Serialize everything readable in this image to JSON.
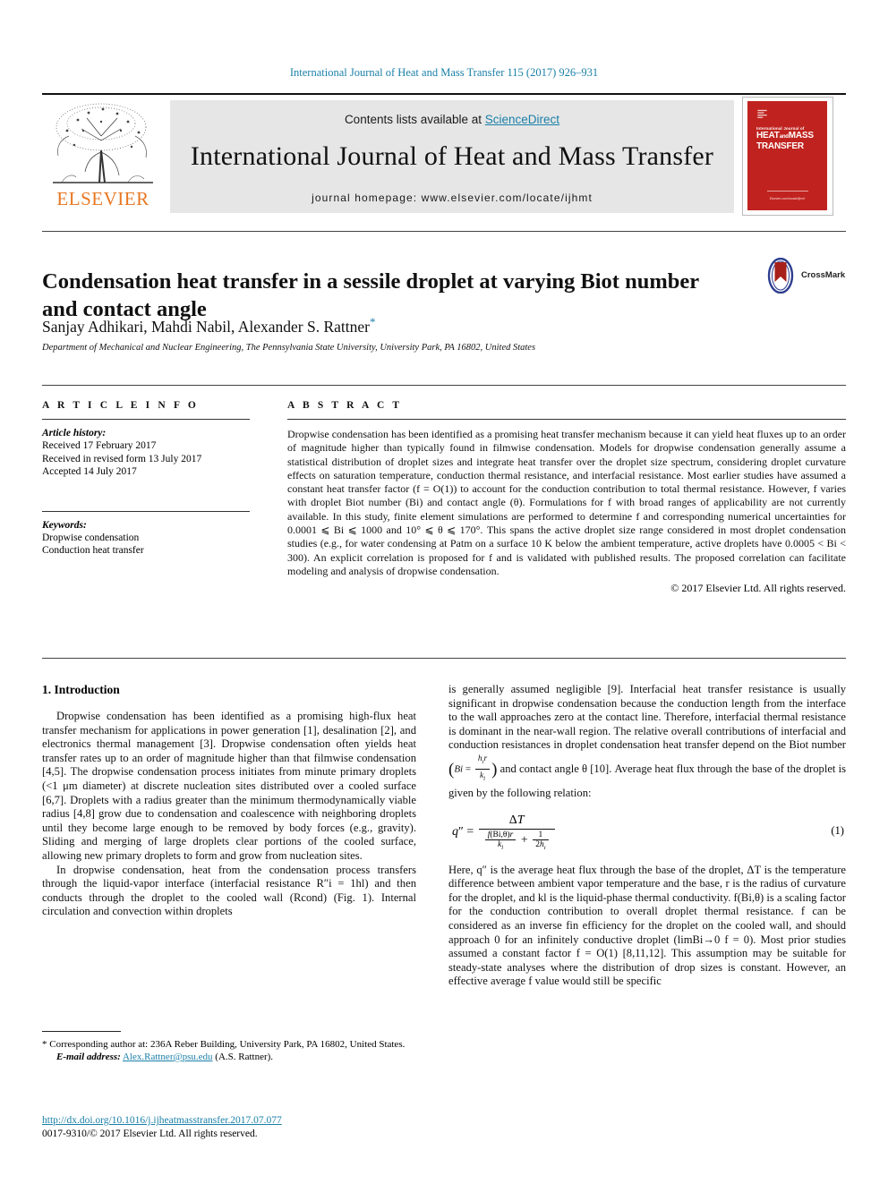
{
  "running_head": "International Journal of Heat and Mass Transfer 115 (2017) 926–931",
  "masthead": {
    "contents_prefix": "Contents lists available at ",
    "sciencedirect": "ScienceDirect",
    "journal_title": "International Journal of Heat and Mass Transfer",
    "homepage": "journal homepage: www.elsevier.com/locate/ijhmt",
    "publisher_name": "ELSEVIER",
    "cover": {
      "line1": "International Journal of",
      "line2_a": "HEAT",
      "line2_b": "and",
      "line2_c": "MASS",
      "line3": "TRANSFER",
      "footer": "Elsevier.com/locate/ijhmt"
    }
  },
  "article": {
    "title": "Condensation heat transfer in a sessile droplet at varying Biot number and contact angle",
    "authors": "Sanjay Adhikari, Mahdi Nabil, Alexander S. Rattner",
    "corresponding_marker": "*",
    "affiliation": "Department of Mechanical and Nuclear Engineering, The Pennsylvania State University, University Park, PA 16802, United States",
    "crossmark_label": "CrossMark"
  },
  "article_info": {
    "heading": "A R T I C L E   I N F O",
    "history_label": "Article history:",
    "history": [
      "Received 17 February 2017",
      "Received in revised form 13 July 2017",
      "Accepted 14 July 2017"
    ],
    "keywords_label": "Keywords:",
    "keywords": [
      "Dropwise condensation",
      "Conduction heat transfer"
    ]
  },
  "abstract": {
    "heading": "A B S T R A C T",
    "body": "Dropwise condensation has been identified as a promising heat transfer mechanism because it can yield heat fluxes up to an order of magnitude higher than typically found in filmwise condensation. Models for dropwise condensation generally assume a statistical distribution of droplet sizes and integrate heat transfer over the droplet size spectrum, considering droplet curvature effects on saturation temperature, conduction thermal resistance, and interfacial resistance. Most earlier studies have assumed a constant heat transfer factor (f = O(1)) to account for the conduction contribution to total thermal resistance. However, f varies with droplet Biot number (Bi) and contact angle (θ). Formulations for f with broad ranges of applicability are not currently available. In this study, finite element simulations are performed to determine f and corresponding numerical uncertainties for 0.0001 ⩽ Bi ⩽ 1000 and 10° ⩽ θ ⩽ 170°. This spans the active droplet size range considered in most droplet condensation studies (e.g., for water condensing at Patm on a surface 10 K below the ambient temperature, active droplets have 0.0005 < Bi < 300). An explicit correlation is proposed for f and is validated with published results. The proposed correlation can facilitate modeling and analysis of dropwise condensation.",
    "copyright": "© 2017 Elsevier Ltd. All rights reserved."
  },
  "body": {
    "section_number_title": "1. Introduction",
    "left_paragraphs": [
      "Dropwise condensation has been identified as a promising high-flux heat transfer mechanism for applications in power generation [1], desalination [2], and electronics thermal management [3]. Dropwise condensation often yields heat transfer rates up to an order of magnitude higher than that filmwise condensation [4,5]. The dropwise condensation process initiates from minute primary droplets (<1 μm diameter) at discrete nucleation sites distributed over a cooled surface [6,7]. Droplets with a radius greater than the minimum thermodynamically viable radius [4,8] grow due to condensation and coalescence with neighboring droplets until they become large enough to be removed by body forces (e.g., gravity). Sliding and merging of large droplets clear portions of the cooled surface, allowing new primary droplets to form and grow from nucleation sites.",
      "In dropwise condensation, heat from the condensation process transfers through the liquid-vapor interface (interfacial resistance R″i = 1hl) and then conducts through the droplet to the cooled wall (Rcond) (Fig. 1). Internal circulation and convection within droplets"
    ],
    "right_paragraph_1": "is generally assumed negligible [9]. Interfacial heat transfer resistance is usually significant in dropwise condensation because the conduction length from the interface to the wall approaches zero at the contact line. Therefore, interfacial thermal resistance is dominant in the near-wall region. The relative overall contributions of interfacial and conduction resistances in droplet condensation heat transfer depend on the Biot number",
    "right_paragraph_1_tail": "and contact angle θ [10]. Average heat flux through the base of the droplet is given by the following relation:",
    "right_paragraph_2": "Here, q″ is the average heat flux through the base of the droplet, ΔT is the temperature difference between ambient vapor temperature and the base, r is the radius of curvature for the droplet, and kl is the liquid-phase thermal conductivity. f(Bi,θ) is a scaling factor for the conduction contribution to overall droplet thermal resistance. f can be considered as an inverse fin efficiency for the droplet on the cooled wall, and should approach 0 for an infinitely conductive droplet (limBi→0 f = 0). Most prior studies assumed a constant factor f = O(1) [8,11,12]. This assumption may be suitable for steady-state analyses where the distribution of drop sizes is constant. However, an effective average f value would still be specific",
    "equation_number": "(1)",
    "equation_text": "q″ = ΔT / ( f(Bi,θ)r/kl + 1/2hi )"
  },
  "footnotes": {
    "corresponding": "* Corresponding author at: 236A Reber Building, University Park, PA 16802, United States.",
    "email_label": "E-mail address:",
    "email": "Alex.Rattner@psu.edu",
    "email_suffix": "(A.S. Rattner).",
    "doi": "http://dx.doi.org/10.1016/j.ijheatmasstransfer.2017.07.077",
    "issn_copyright": "0017-9310/© 2017 Elsevier Ltd. All rights reserved."
  },
  "colors": {
    "link": "#1a7fa8",
    "elsevier_orange": "#e87722",
    "cover_red": "#c0231f",
    "banner_gray": "#e6e6e6"
  }
}
